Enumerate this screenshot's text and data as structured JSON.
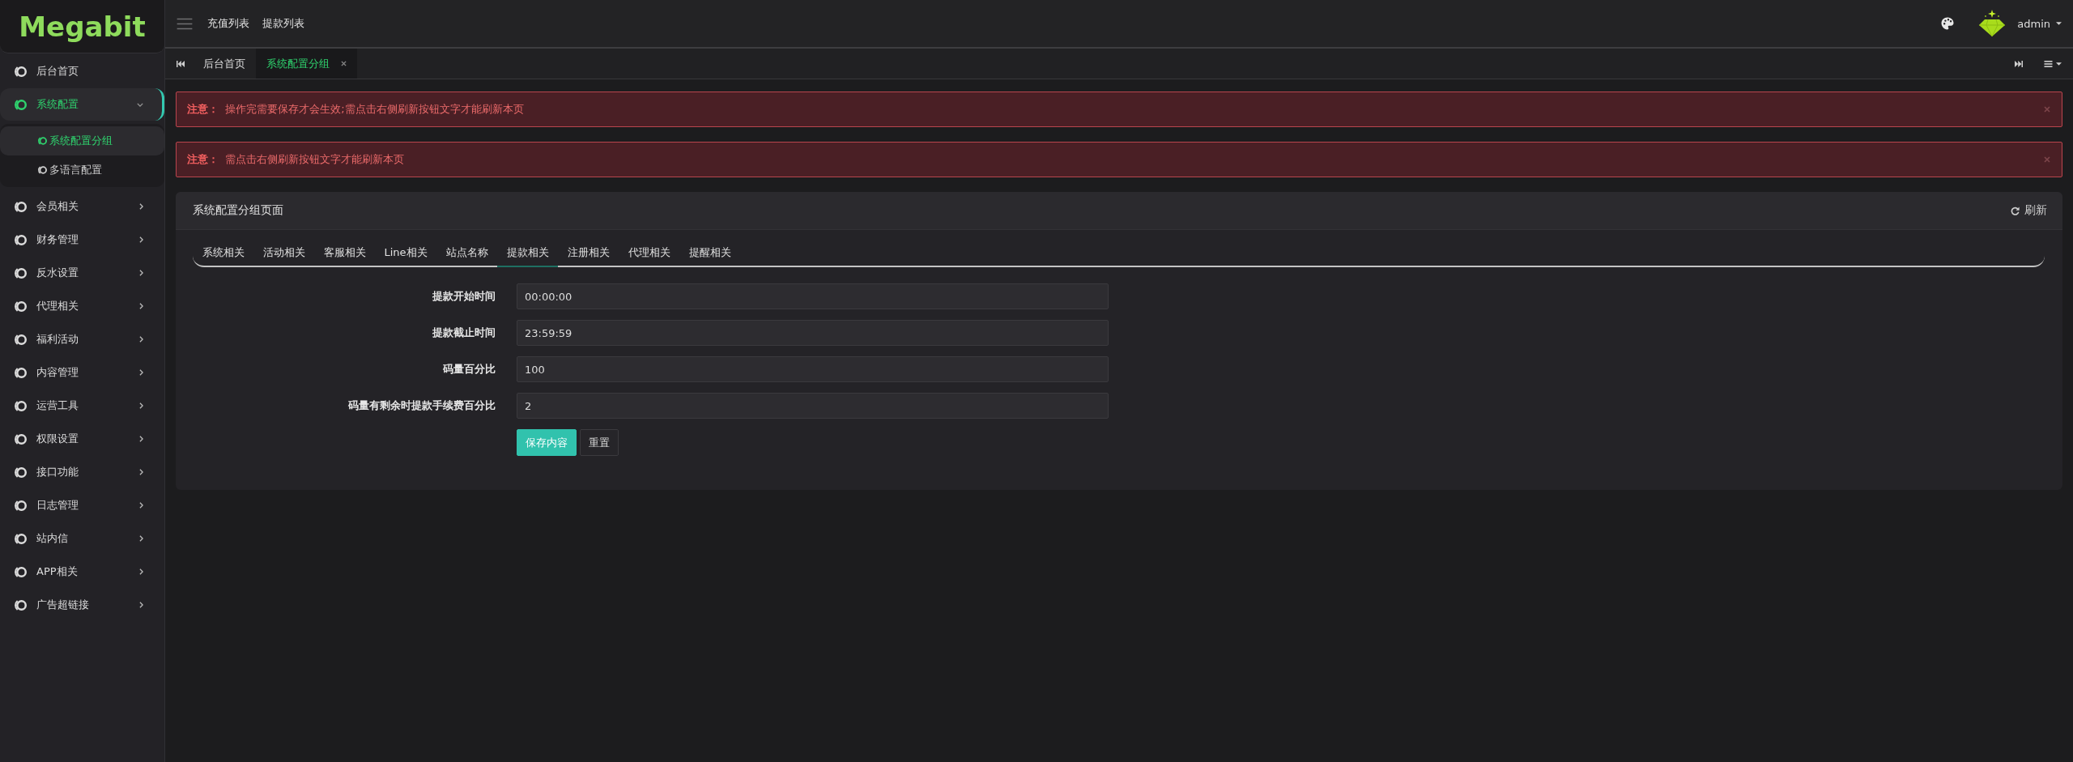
{
  "sidebar": {
    "logo": "Megabit",
    "items": [
      {
        "label": "后台首页",
        "kind": "link",
        "selected": false
      },
      {
        "label": "系统配置",
        "kind": "group",
        "selected": true,
        "expanded": true,
        "children": [
          {
            "label": "系统配置分组",
            "selected": true
          },
          {
            "label": "多语言配置",
            "selected": false
          }
        ]
      },
      {
        "label": "会员相关",
        "kind": "group",
        "selected": false,
        "expanded": false
      },
      {
        "label": "财务管理",
        "kind": "group",
        "selected": false,
        "expanded": false
      },
      {
        "label": "反水设置",
        "kind": "group",
        "selected": false,
        "expanded": false
      },
      {
        "label": "代理相关",
        "kind": "group",
        "selected": false,
        "expanded": false
      },
      {
        "label": "福利活动",
        "kind": "group",
        "selected": false,
        "expanded": false
      },
      {
        "label": "内容管理",
        "kind": "group",
        "selected": false,
        "expanded": false
      },
      {
        "label": "运营工具",
        "kind": "group",
        "selected": false,
        "expanded": false
      },
      {
        "label": "权限设置",
        "kind": "group",
        "selected": false,
        "expanded": false
      },
      {
        "label": "接口功能",
        "kind": "group",
        "selected": false,
        "expanded": false
      },
      {
        "label": "日志管理",
        "kind": "group",
        "selected": false,
        "expanded": false
      },
      {
        "label": "站内信",
        "kind": "group",
        "selected": false,
        "expanded": false
      },
      {
        "label": "APP相关",
        "kind": "group",
        "selected": false,
        "expanded": false
      },
      {
        "label": "广告超链接",
        "kind": "group",
        "selected": false,
        "expanded": false
      }
    ]
  },
  "top_bar": {
    "links": [
      "充值列表",
      "提款列表"
    ],
    "user": "admin"
  },
  "page_tabs": [
    {
      "label": "后台首页",
      "selected": false,
      "closable": false
    },
    {
      "label": "系统配置分组",
      "selected": true,
      "closable": true
    }
  ],
  "alerts": [
    {
      "text": "**注意：** 操作完需要保存才会生效;需点击右侧刷新按钮文字才能刷新本页"
    },
    {
      "text": "**注意：** 需点击右侧刷新按钮文字才能刷新本页"
    }
  ],
  "panel": {
    "title": "系统配置分组页面",
    "refresh": "刷新",
    "tabs": [
      {
        "label": "系统相关",
        "selected": false
      },
      {
        "label": "活动相关",
        "selected": false
      },
      {
        "label": "客服相关",
        "selected": false
      },
      {
        "label": "Line相关",
        "selected": false
      },
      {
        "label": "站点名称",
        "selected": false
      },
      {
        "label": "提款相关",
        "selected": true
      },
      {
        "label": "注册相关",
        "selected": false
      },
      {
        "label": "代理相关",
        "selected": false
      },
      {
        "label": "提醒相关",
        "selected": false
      }
    ],
    "fields": [
      {
        "label": "提款开始时间",
        "value": "00:00:00"
      },
      {
        "label": "提款截止时间",
        "value": "23:59:59"
      },
      {
        "label": "码量百分比",
        "value": "100"
      },
      {
        "label": "码量有剩余时提款手续费百分比",
        "value": "2"
      }
    ],
    "buttons": [
      {
        "label": "保存内容",
        "kind": "submit"
      },
      {
        "label": "重置",
        "kind": "reset"
      }
    ]
  }
}
